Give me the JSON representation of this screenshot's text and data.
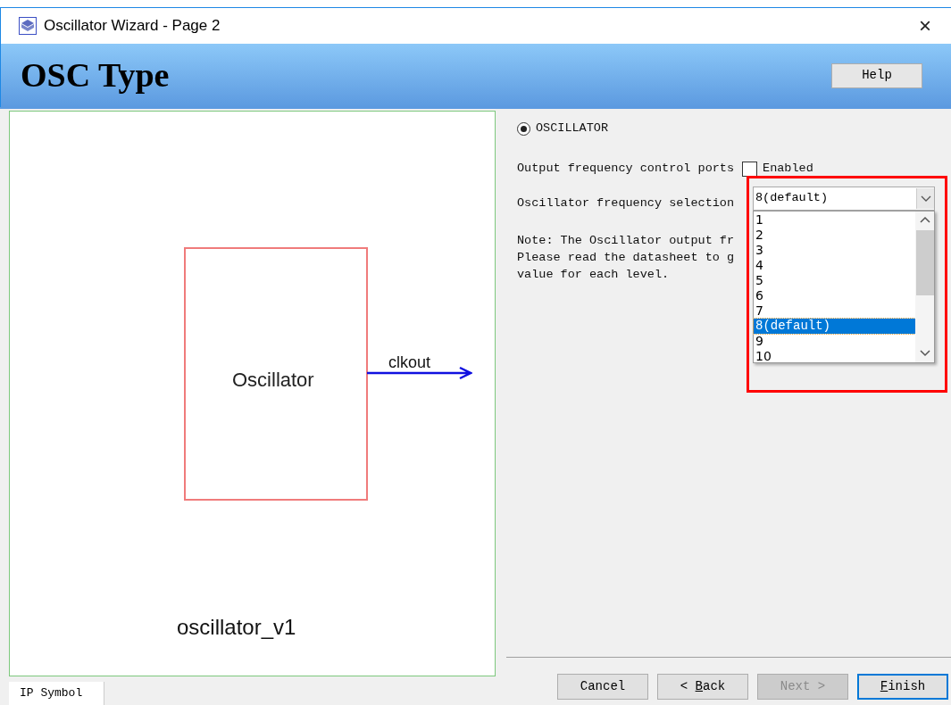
{
  "window": {
    "title": "Oscillator Wizard - Page 2",
    "close": "×"
  },
  "header": {
    "title": "OSC Type",
    "help_button": "Help"
  },
  "symbol": {
    "block_label": "Oscillator",
    "port": "clkout",
    "instance": "oscillator_v1"
  },
  "tabs": [
    {
      "label": "IP Symbol",
      "selected": true
    }
  ],
  "options": {
    "radio": {
      "label": "OSCILLATOR",
      "selected": true
    },
    "ports_label": "Output frequency control ports",
    "ports_checkbox": {
      "label": "Enabled",
      "checked": false
    },
    "freq_label": "Oscillator frequency selection",
    "freq_value": "8(default)",
    "dropdown_items": [
      {
        "label": "1",
        "selected": false
      },
      {
        "label": "2",
        "selected": false
      },
      {
        "label": "3",
        "selected": false
      },
      {
        "label": "4",
        "selected": false
      },
      {
        "label": "5",
        "selected": false
      },
      {
        "label": "6",
        "selected": false
      },
      {
        "label": "7",
        "selected": false
      },
      {
        "label": "8(default)",
        "selected": true
      },
      {
        "label": "9",
        "selected": false
      },
      {
        "label": "10",
        "selected": false
      }
    ],
    "note_lines": [
      "Note: The Oscillator output fr",
      "Please read the datasheet to g",
      "value for each level."
    ],
    "highlighted": true
  },
  "buttons": [
    {
      "label": "Cancel",
      "disabled": false,
      "focused": false,
      "mnemonic": false
    },
    {
      "label": "< Back",
      "disabled": false,
      "focused": false,
      "mnemonic": true
    },
    {
      "label": "Next >",
      "disabled": true,
      "focused": false,
      "mnemonic": false
    },
    {
      "label": "Finish",
      "disabled": false,
      "focused": true,
      "mnemonic": true
    }
  ]
}
